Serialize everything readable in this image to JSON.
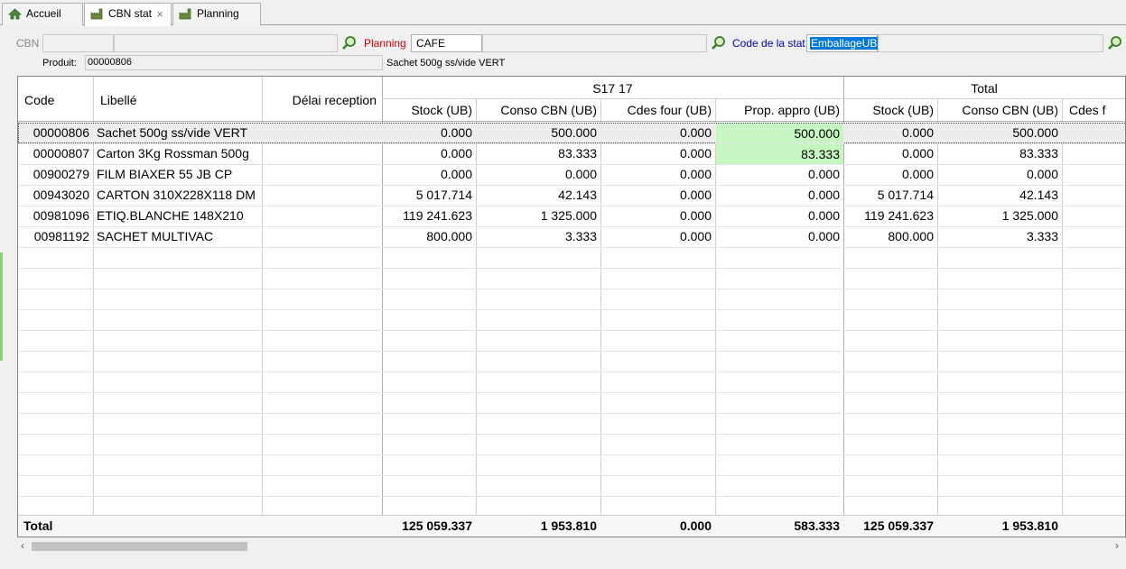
{
  "tabs": [
    {
      "label": "Accueil"
    },
    {
      "label": "CBN stat",
      "close": "×"
    },
    {
      "label": "Planning"
    }
  ],
  "form": {
    "cbn_label": "CBN",
    "cbn_value": "",
    "planning_label": "Planning",
    "planning_value": "CAFE",
    "code_stat_label": "Code de la stat",
    "code_stat_value": "EmballageUB",
    "produit_label": "Produit:",
    "produit_value": "00000806",
    "produit_desc": "Sachet 500g ss/vide VERT"
  },
  "grid": {
    "headers": {
      "code": "Code",
      "libelle": "Libellé",
      "delai": "Délai reception",
      "group1": "S17 17",
      "group2": "Total",
      "sub": [
        "Stock (UB)",
        "Conso CBN (UB)",
        "Cdes four (UB)",
        "Prop. appro (UB)",
        "Stock (UB)",
        "Conso CBN (UB)",
        "Cdes f"
      ]
    },
    "rows": [
      {
        "code": "00000806",
        "libelle": "Sachet 500g ss/vide VERT",
        "delai": "",
        "v": [
          "0.000",
          "500.000",
          "0.000",
          "500.000",
          "0.000",
          "500.000"
        ]
      },
      {
        "code": "00000807",
        "libelle": "Carton 3Kg Rossman 500g",
        "delai": "",
        "v": [
          "0.000",
          "83.333",
          "0.000",
          "83.333",
          "0.000",
          "83.333"
        ]
      },
      {
        "code": "00900279",
        "libelle": "FILM BIAXER 55 JB CP",
        "delai": "",
        "v": [
          "0.000",
          "0.000",
          "0.000",
          "0.000",
          "0.000",
          "0.000"
        ]
      },
      {
        "code": "00943020",
        "libelle": "CARTON 310X228X118 DM",
        "delai": "",
        "v": [
          "5 017.714",
          "42.143",
          "0.000",
          "0.000",
          "5 017.714",
          "42.143"
        ]
      },
      {
        "code": "00981096",
        "libelle": "ETIQ.BLANCHE 148X210",
        "delai": "",
        "v": [
          "119 241.623",
          "1 325.000",
          "0.000",
          "0.000",
          "119 241.623",
          "1 325.000"
        ]
      },
      {
        "code": "00981192",
        "libelle": "SACHET MULTIVAC",
        "delai": "",
        "v": [
          "800.000",
          "3.333",
          "0.000",
          "0.000",
          "800.000",
          "3.333"
        ]
      }
    ],
    "total": {
      "label": "Total",
      "v": [
        "125 059.337",
        "1 953.810",
        "0.000",
        "583.333",
        "125 059.337",
        "1 953.810"
      ]
    }
  },
  "colors": {
    "highlight": "#c6f7c0",
    "planning_label": "#d40000",
    "code_stat_label": "#0000c8",
    "selection": "#0078d7"
  }
}
